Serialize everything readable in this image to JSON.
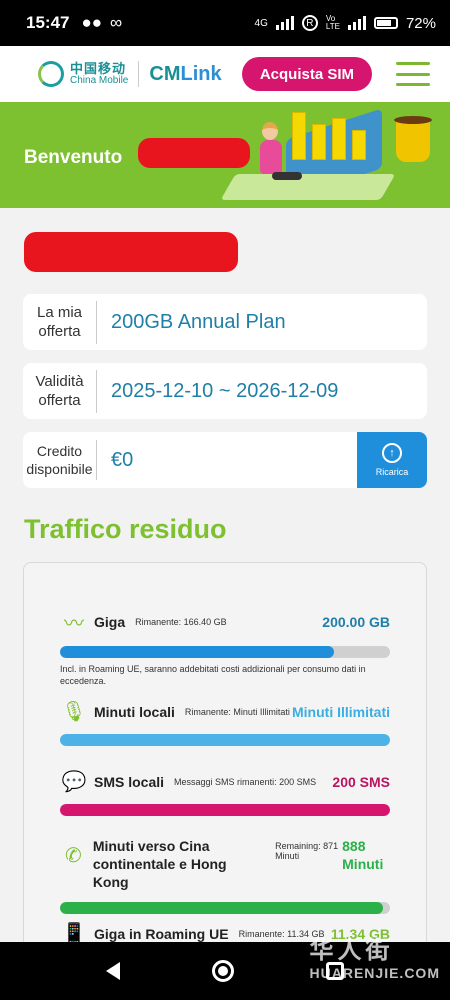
{
  "status_bar": {
    "time": "15:47",
    "battery": "72%",
    "network": "4G"
  },
  "header": {
    "logo_cn": "中国移动",
    "logo_en": "China Mobile",
    "logo_cmlink_a": "CM",
    "logo_cmlink_b": "Link",
    "buy_sim_label": "Acquista SIM"
  },
  "banner": {
    "welcome_text": "Benvenuto"
  },
  "offer": {
    "label": "La mia offerta",
    "value": "200GB Annual Plan"
  },
  "validity": {
    "label": "Validità offerta",
    "value": "2025-12-10 ~ 2026-12-09"
  },
  "credit": {
    "label": "Credito disponibile",
    "value": "€0",
    "recharge_label": "Ricarica"
  },
  "traffic": {
    "title": "Traffico residuo",
    "items": [
      {
        "name": "Giga",
        "remaining": "Rimanente: 166.40 GB",
        "amount": "200.00 GB",
        "fill_percent": 83,
        "color": "#1f8fdc",
        "amount_color": "#1f7fa8",
        "icon": "pulse-icon",
        "note": "Incl. in Roaming UE, saranno addebitati costi addizionali per consumo dati in eccedenza."
      },
      {
        "name": "Minuti locali",
        "remaining": "Rimanente: Minuti Illimitati",
        "amount": "Minuti Illimitati",
        "fill_percent": 100,
        "color": "#4db3e6",
        "amount_color": "#3aaee0",
        "icon": "microphone-icon"
      },
      {
        "name": "SMS locali",
        "remaining": "Messaggi SMS rimanenti: 200 SMS",
        "amount": "200 SMS",
        "fill_percent": 100,
        "color": "#d6166e",
        "amount_color": "#b8145f",
        "icon": "chat-icon"
      },
      {
        "name": "Minuti verso Cina continentale e Hong Kong",
        "remaining": "Remaining: 871 Minuti",
        "amount": "888 Minuti",
        "fill_percent": 98,
        "color": "#2bb04a",
        "amount_color": "#2bb04a",
        "icon": "phone-icon"
      },
      {
        "name": "Giga in Roaming UE",
        "remaining": "Rimanente: 11.34 GB",
        "amount": "11.34 GB",
        "fill_percent": 100,
        "color": "#7dc030",
        "amount_color": "#7dc030",
        "icon": "roaming-phone-icon"
      }
    ]
  },
  "watermark": {
    "line1": "华人街",
    "line2": "HUARENJIE.COM"
  }
}
